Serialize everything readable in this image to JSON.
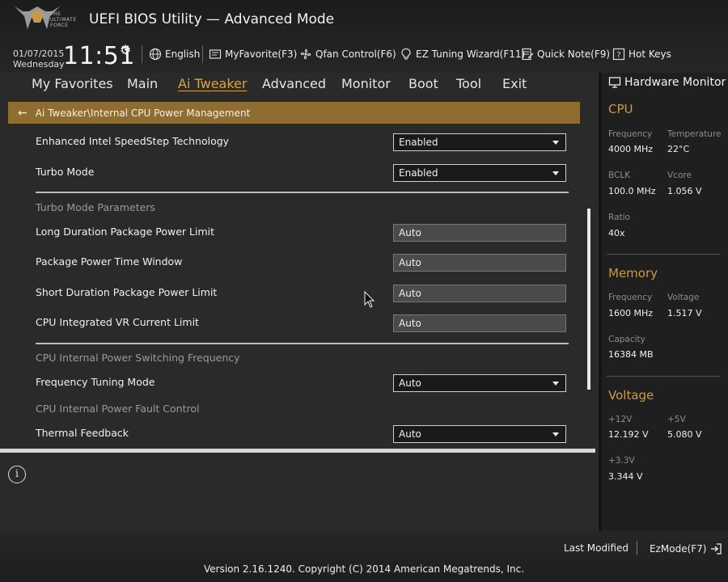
{
  "header": {
    "logo_text": "THE ULTIMATE FORCE",
    "title": "UEFI BIOS Utility — Advanced Mode",
    "date": "01/07/2015",
    "weekday": "Wednesday",
    "time": "11:51",
    "toolbar": [
      {
        "label": "English",
        "icon": "globe-icon"
      },
      {
        "label": "MyFavorite(F3)",
        "icon": "favorite-icon"
      },
      {
        "label": "Qfan Control(F6)",
        "icon": "fan-icon"
      },
      {
        "label": "EZ Tuning Wizard(F11)",
        "icon": "lightbulb-icon"
      },
      {
        "label": "Quick Note(F9)",
        "icon": "note-icon"
      },
      {
        "label": "Hot Keys",
        "icon": "question-icon"
      }
    ]
  },
  "menu": {
    "items": [
      "My Favorites",
      "Main",
      "Ai Tweaker",
      "Advanced",
      "Monitor",
      "Boot",
      "Tool",
      "Exit"
    ],
    "active": "Ai Tweaker"
  },
  "breadcrumb": "Ai Tweaker\\Internal CPU Power Management",
  "settings": {
    "speedstep": {
      "label": "Enhanced Intel SpeedStep Technology",
      "value": "Enabled"
    },
    "turbo": {
      "label": "Turbo Mode",
      "value": "Enabled"
    },
    "turbo_params_header": "Turbo Mode Parameters",
    "long_duration": {
      "label": "Long Duration Package Power Limit",
      "value": "Auto"
    },
    "time_window": {
      "label": "Package Power Time Window",
      "value": "Auto"
    },
    "short_duration": {
      "label": "Short Duration Package Power Limit",
      "value": "Auto"
    },
    "vr_current": {
      "label": "CPU Integrated VR Current Limit",
      "value": "Auto"
    },
    "switching_header": "CPU Internal Power Switching Frequency",
    "freq_tuning": {
      "label": "Frequency Tuning Mode",
      "value": "Auto"
    },
    "fault_header": "CPU Internal Power Fault Control",
    "thermal": {
      "label": "Thermal Feedback",
      "value": "Auto"
    }
  },
  "hardware_monitor": {
    "title": "Hardware Monitor",
    "cpu": {
      "title": "CPU",
      "frequency_label": "Frequency",
      "frequency": "4000 MHz",
      "temperature_label": "Temperature",
      "temperature": "22°C",
      "bclk_label": "BCLK",
      "bclk": "100.0 MHz",
      "vcore_label": "Vcore",
      "vcore": "1.056 V",
      "ratio_label": "Ratio",
      "ratio": "40x"
    },
    "memory": {
      "title": "Memory",
      "frequency_label": "Frequency",
      "frequency": "1600 MHz",
      "voltage_label": "Voltage",
      "voltage": "1.517 V",
      "capacity_label": "Capacity",
      "capacity": "16384 MB"
    },
    "voltage": {
      "title": "Voltage",
      "v12_label": "+12V",
      "v12": "12.192 V",
      "v5_label": "+5V",
      "v5": "5.080 V",
      "v33_label": "+3.3V",
      "v33": "3.344 V"
    }
  },
  "footer": {
    "last_modified": "Last Modified",
    "ezmode": "EzMode(F7)",
    "copyright": "Version 2.16.1240. Copyright (C) 2014 American Megatrends, Inc."
  },
  "colors": {
    "accent": "#c89a48",
    "breadcrumb_bg": "#8f6c2f",
    "background": "#2a2a2a"
  }
}
